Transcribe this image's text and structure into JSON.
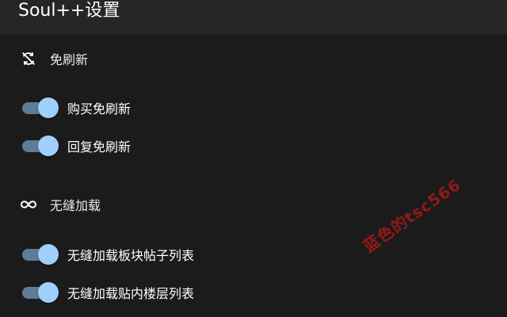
{
  "app": {
    "title": "Soul++设置"
  },
  "sections": [
    {
      "label": "免刷新",
      "icon": "sync-off-icon",
      "toggles": [
        {
          "label": "购买免刷新",
          "on": true
        },
        {
          "label": "回复免刷新",
          "on": true
        }
      ]
    },
    {
      "label": "无缝加载",
      "icon": "infinity-icon",
      "toggles": [
        {
          "label": "无缝加载板块帖子列表",
          "on": true
        },
        {
          "label": "无缝加载贴内楼层列表",
          "on": true
        }
      ]
    }
  ],
  "colors": {
    "background": "#1b1b1b",
    "header": "#262626",
    "switch_track_on": "#5e7c96",
    "switch_thumb_on": "#9fd0fb",
    "watermark": "#a81818"
  },
  "watermark": {
    "text": "蓝色的tsc566"
  }
}
